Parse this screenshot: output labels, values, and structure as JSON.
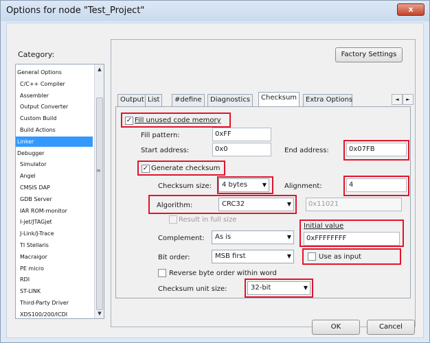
{
  "window": {
    "title": "Options for node \"Test_Project\"",
    "close_glyph": "x"
  },
  "category": {
    "label": "Category:",
    "items": [
      "General Options",
      "C/C++ Compiler",
      "Assembler",
      "Output Converter",
      "Custom Build",
      "Build Actions",
      "Linker",
      "Debugger",
      "Simulator",
      "Angel",
      "CMSIS DAP",
      "GDB Server",
      "IAR ROM-monitor",
      "I-jet/JTAGjet",
      "J-Link/J-Trace",
      "TI Stellaris",
      "Macraigor",
      "PE micro",
      "RDI",
      "ST-LINK",
      "Third-Party Driver",
      "XDS100/200/ICDI"
    ],
    "selected": "Linker"
  },
  "factory_settings_label": "Factory Settings",
  "tabs": [
    "Output",
    "List",
    "#define",
    "Diagnostics",
    "Checksum",
    "Extra Options"
  ],
  "active_tab": "Checksum",
  "checksum": {
    "fill_unused_label": "Fill unused code memory",
    "fill_unused_checked": true,
    "fill_pattern_label": "Fill pattern:",
    "fill_pattern_value": "0xFF",
    "start_address_label": "Start address:",
    "start_address_value": "0x0",
    "end_address_label": "End address:",
    "end_address_value": "0x07FB",
    "generate_checksum_label": "Generate checksum",
    "generate_checksum_checked": true,
    "checksum_size_label": "Checksum size:",
    "checksum_size_value": "4 bytes",
    "alignment_label": "Alignment:",
    "alignment_value": "4",
    "algorithm_label": "Algorithm:",
    "algorithm_value": "CRC32",
    "polynomial_value": "0x11021",
    "result_full_size_label": "Result in full size",
    "initial_value_label": "Initial value",
    "initial_value_value": "0xFFFFFFFF",
    "complement_label": "Complement:",
    "complement_value": "As is",
    "bit_order_label": "Bit order:",
    "bit_order_value": "MSB first",
    "use_as_input_label": "Use as input",
    "reverse_byte_order_label": "Reverse byte order within word",
    "unit_size_label": "Checksum unit size:",
    "unit_size_value": "32-bit"
  },
  "ok_label": "OK",
  "cancel_label": "Cancel"
}
